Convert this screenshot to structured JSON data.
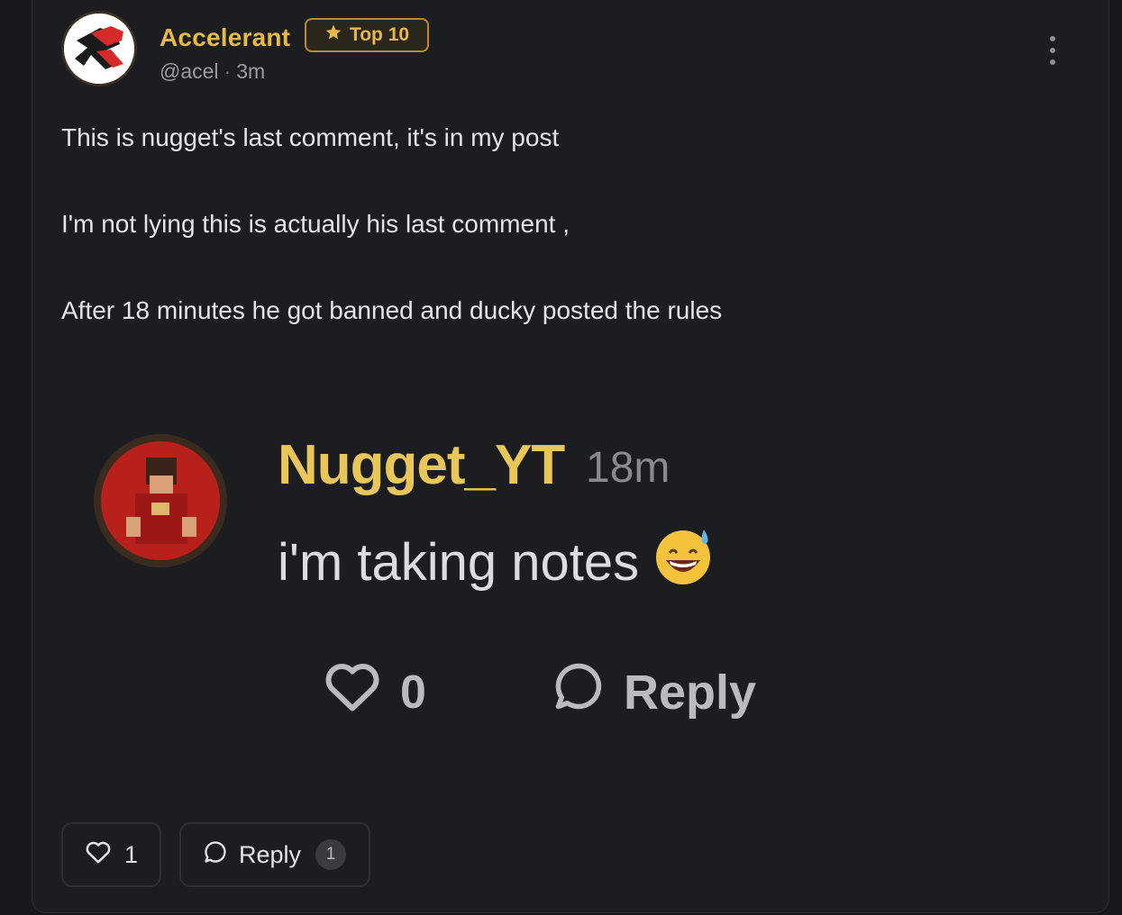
{
  "post": {
    "author": "Accelerant",
    "badge_label": "Top 10",
    "handle": "@acel",
    "separator": "·",
    "time": "3m",
    "paragraphs": [
      "This is nugget's last comment, it's in my post",
      "I'm not lying this is actually his last comment ,",
      "After 18 minutes he got banned and ducky posted the rules"
    ]
  },
  "embedded_comment": {
    "author": "Nugget_YT",
    "time": "18m",
    "text": "i'm taking notes",
    "emoji": "😅",
    "like_count": "0",
    "reply_label": "Reply"
  },
  "actions": {
    "like_count": "1",
    "reply_label": "Reply",
    "reply_count": "1"
  },
  "colors": {
    "accent_gold": "#e8b949",
    "background": "#1c1d21"
  },
  "icons": [
    "star-icon",
    "more-vertical-icon",
    "heart-icon",
    "comment-icon"
  ]
}
